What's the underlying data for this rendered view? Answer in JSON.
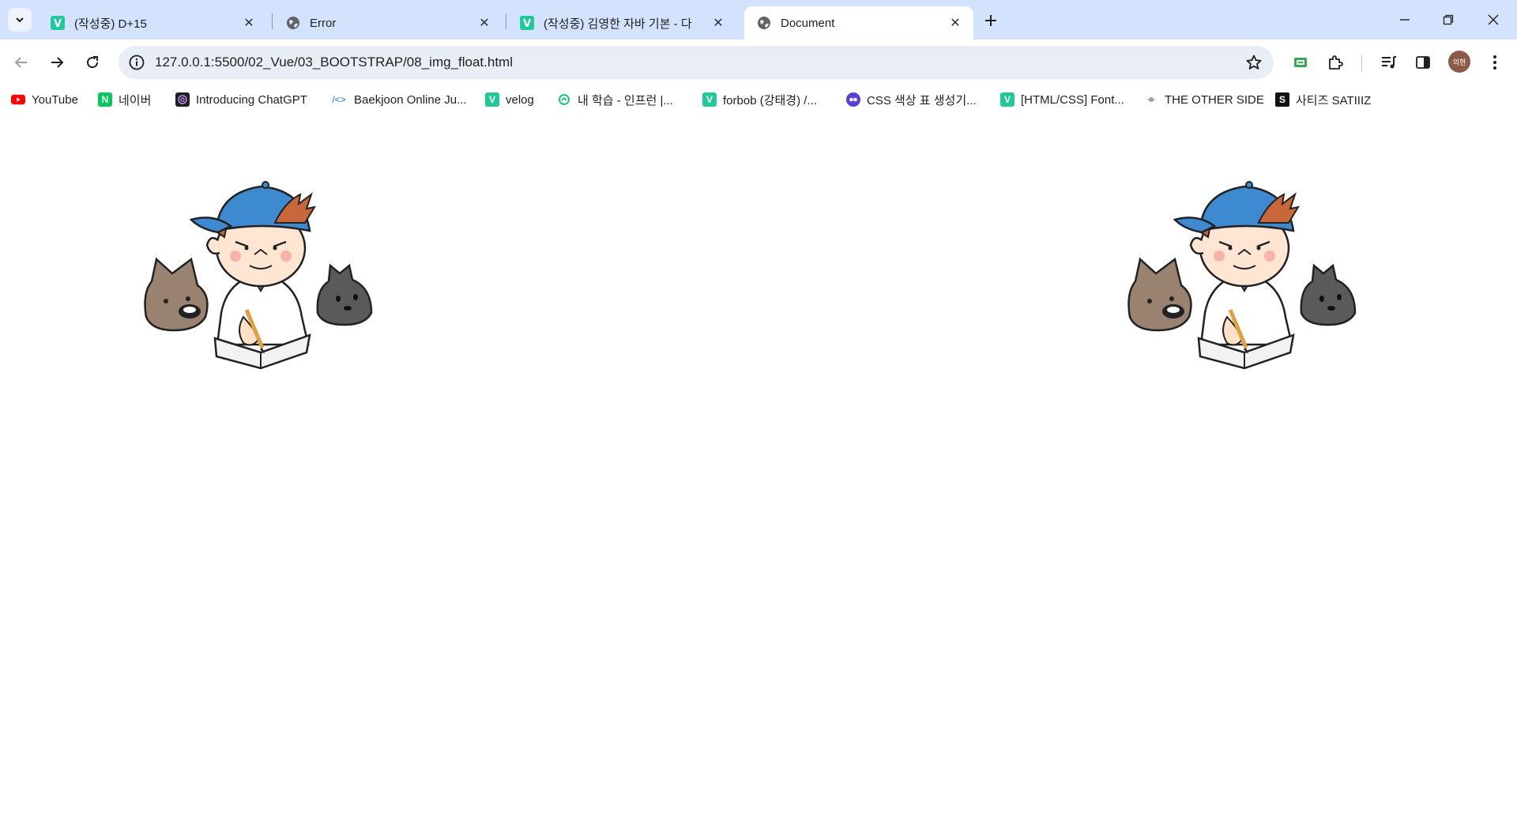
{
  "browser": {
    "tabs": [
      {
        "title": "(작성중) D+15",
        "favicon": "velog-icon"
      },
      {
        "title": "Error",
        "favicon": "globe-icon"
      },
      {
        "title": "(작성중) 김영한 자바 기본 - 다",
        "favicon": "velog-icon"
      },
      {
        "title": "Document",
        "favicon": "globe-icon",
        "active": true
      }
    ],
    "address": {
      "url": "127.0.0.1:5500/02_Vue/03_BOOTSTRAP/08_img_float.html"
    },
    "profile": {
      "initials": "의현"
    }
  },
  "bookmarks": [
    {
      "label": "YouTube",
      "icon": "youtube-icon",
      "color": "#ff0000"
    },
    {
      "label": "네이버",
      "icon": "naver-icon",
      "color": "#03c75a"
    },
    {
      "label": "Introducing ChatGPT",
      "icon": "chatgpt-icon",
      "color": "#1f1f1f"
    },
    {
      "label": "Baekjoon Online Ju...",
      "icon": "code-icon",
      "color": "#1a73e8"
    },
    {
      "label": "velog",
      "icon": "velog-icon",
      "color": "#20c997"
    },
    {
      "label": "내 학습 - 인프런 |...",
      "icon": "inflearn-icon",
      "color": "#00c471"
    },
    {
      "label": "forbob (강태경) /...",
      "icon": "velog-icon",
      "color": "#20c997"
    },
    {
      "label": "CSS 색상 표 생성기...",
      "icon": "palette-icon",
      "color": "#5b3ed6"
    },
    {
      "label": "[HTML/CSS] Font...",
      "icon": "velog-icon",
      "color": "#20c997"
    },
    {
      "label": "THE OTHER SIDE",
      "icon": "dot-icon",
      "color": "#9aa0a6"
    },
    {
      "label": "사티즈 SATIIIZ",
      "icon": "satiiiz-icon",
      "color": "#111111"
    }
  ],
  "page": {
    "images": [
      {
        "name": "studying-boy-illustration",
        "float": "left"
      },
      {
        "name": "studying-boy-illustration",
        "float": "right"
      }
    ]
  }
}
